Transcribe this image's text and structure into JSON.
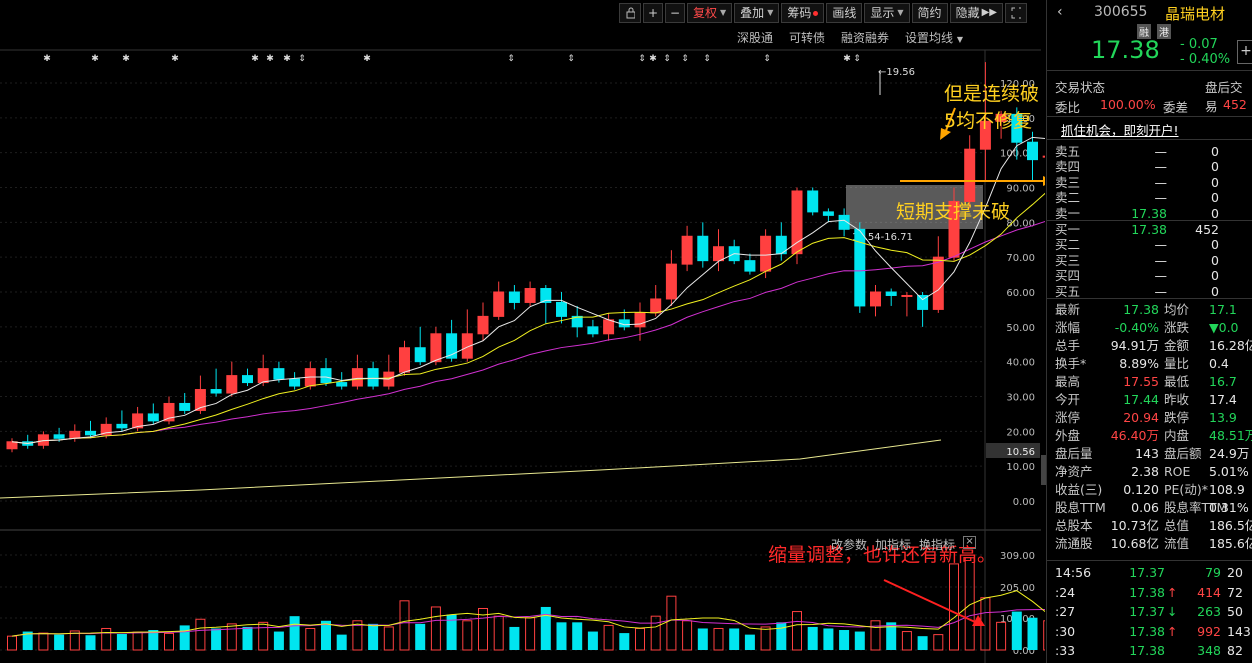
{
  "toolbar": {
    "items": [
      {
        "label": "复权",
        "dropdown": true,
        "active": true
      },
      {
        "label": "叠加",
        "dropdown": true
      },
      {
        "label": "筹码",
        "dot": true
      },
      {
        "label": "画线"
      },
      {
        "label": "显示",
        "dropdown": true
      },
      {
        "label": "简约"
      },
      {
        "label": "隐藏"
      }
    ],
    "sub_items": [
      "深股通",
      "可转债",
      "融资融券",
      "设置均线"
    ]
  },
  "annotations": {
    "top_note": "但是连续破5均不修复",
    "support_note": "短期支撑未破",
    "volume_note": "缩量调整，也许还有新高。",
    "high_marker": "19.56",
    "range_label": "15.54-16.71",
    "vol_buttons": [
      "改参数",
      "加指标",
      "换指标"
    ]
  },
  "price_axis": {
    "ticks": [
      "120.00",
      "110.00",
      "100.00",
      "90.00",
      "80.00",
      "70.00",
      "60.00",
      "50.00",
      "40.00",
      "30.00",
      "20.00",
      "10.00",
      "0.00"
    ],
    "current": "10.56"
  },
  "vol_axis": {
    "ticks": [
      "309.00",
      "205.00",
      "104.00",
      "0.00"
    ]
  },
  "quote": {
    "code": "300655",
    "name": "晶瑞电材",
    "tags": [
      "融",
      "港"
    ],
    "price": "17.38",
    "change": "- 0.07",
    "change_pct": "- 0.40%",
    "status_left": "交易状态",
    "status_right": "盘后交易",
    "weibi_label": "委比",
    "weibi": "100.00%",
    "weicha_label": "委差",
    "weicha": "452",
    "promo": "抓住机会，即刻开户!",
    "asks": [
      {
        "label": "卖五",
        "price": "—",
        "vol": "0"
      },
      {
        "label": "卖四",
        "price": "—",
        "vol": "0"
      },
      {
        "label": "卖三",
        "price": "—",
        "vol": "0"
      },
      {
        "label": "卖二",
        "price": "—",
        "vol": "0"
      },
      {
        "label": "卖一",
        "price": "17.38",
        "vol": "0"
      }
    ],
    "bids": [
      {
        "label": "买一",
        "price": "17.38",
        "vol": "452"
      },
      {
        "label": "买二",
        "price": "—",
        "vol": "0"
      },
      {
        "label": "买三",
        "price": "—",
        "vol": "0"
      },
      {
        "label": "买四",
        "price": "—",
        "vol": "0"
      },
      {
        "label": "买五",
        "price": "—",
        "vol": "0"
      }
    ],
    "stats": [
      {
        "l1": "最新",
        "v1": "17.38",
        "c1": "green",
        "l2": "均价",
        "v2": "17.1",
        "c2": "green"
      },
      {
        "l1": "涨幅",
        "v1": "-0.40%",
        "c1": "green",
        "l2": "涨跌",
        "v2": "▼0.0",
        "c2": "green"
      },
      {
        "l1": "总手",
        "v1": "94.91万",
        "c1": "white",
        "l2": "金额",
        "v2": "16.28亿",
        "c2": "white"
      },
      {
        "l1": "换手*",
        "v1": "8.89%",
        "c1": "white",
        "l2": "量比",
        "v2": "0.4",
        "c2": "white"
      },
      {
        "l1": "最高",
        "v1": "17.55",
        "c1": "red",
        "l2": "最低",
        "v2": "16.7",
        "c2": "green"
      },
      {
        "l1": "今开",
        "v1": "17.44",
        "c1": "green",
        "l2": "昨收",
        "v2": "17.4",
        "c2": "white"
      },
      {
        "l1": "涨停",
        "v1": "20.94",
        "c1": "red",
        "l2": "跌停",
        "v2": "13.9",
        "c2": "green"
      },
      {
        "l1": "外盘",
        "v1": "46.40万",
        "c1": "red",
        "l2": "内盘",
        "v2": "48.51万",
        "c2": "green"
      },
      {
        "l1": "盘后量",
        "v1": "143",
        "c1": "white",
        "l2": "盘后额",
        "v2": "24.9万",
        "c2": "white"
      },
      {
        "l1": "净资产",
        "v1": "2.38",
        "c1": "white",
        "l2": "ROE",
        "v2": "5.01%",
        "c2": "white"
      },
      {
        "l1": "收益(三)",
        "v1": "0.120",
        "c1": "white",
        "l2": "PE(动)*",
        "v2": "108.9",
        "c2": "white"
      },
      {
        "l1": "股息TTM",
        "v1": "0.06",
        "c1": "white",
        "l2": "股息率TTM",
        "v2": "0.31%",
        "c2": "white"
      },
      {
        "l1": "总股本",
        "v1": "10.73亿",
        "c1": "white",
        "l2": "总值",
        "v2": "186.5亿",
        "c2": "white"
      },
      {
        "l1": "流通股",
        "v1": "10.68亿",
        "c1": "white",
        "l2": "流值",
        "v2": "185.6亿",
        "c2": "white"
      }
    ],
    "ticks": [
      {
        "time": "14:56",
        "price": "17.37",
        "dir": "",
        "vol": "79",
        "n": "20"
      },
      {
        "time": ":24",
        "price": "17.38",
        "dir": "up",
        "vol": "414",
        "n": "72"
      },
      {
        "time": ":27",
        "price": "17.37",
        "dir": "down",
        "vol": "263",
        "n": "50"
      },
      {
        "time": ":30",
        "price": "17.38",
        "dir": "up",
        "vol": "992",
        "n": "143"
      },
      {
        "time": ":33",
        "price": "17.38",
        "dir": "",
        "vol": "348",
        "n": "82"
      }
    ]
  },
  "chart_data": {
    "type": "candlestick",
    "note": "Daily K-line, values in chart axis units (price axis 0-120, volume axis 0-309)",
    "candles": [
      [
        15,
        17,
        14,
        18
      ],
      [
        17,
        16,
        15,
        19
      ],
      [
        16,
        19,
        15,
        20
      ],
      [
        19,
        18,
        17,
        21
      ],
      [
        18,
        20,
        17,
        22
      ],
      [
        20,
        19,
        18,
        23
      ],
      [
        19,
        22,
        18,
        24
      ],
      [
        22,
        21,
        20,
        26
      ],
      [
        21,
        25,
        20,
        27
      ],
      [
        25,
        23,
        22,
        28
      ],
      [
        23,
        28,
        22,
        30
      ],
      [
        28,
        26,
        25,
        31
      ],
      [
        26,
        32,
        25,
        36
      ],
      [
        32,
        31,
        30,
        38
      ],
      [
        31,
        36,
        30,
        40
      ],
      [
        36,
        34,
        33,
        38
      ],
      [
        34,
        38,
        33,
        42
      ],
      [
        38,
        35,
        34,
        40
      ],
      [
        35,
        33,
        32,
        37
      ],
      [
        33,
        38,
        32,
        40
      ],
      [
        38,
        34,
        33,
        41
      ],
      [
        34,
        33,
        32,
        37
      ],
      [
        33,
        38,
        32,
        42
      ],
      [
        38,
        33,
        32,
        40
      ],
      [
        33,
        37,
        32,
        42
      ],
      [
        37,
        44,
        36,
        46
      ],
      [
        44,
        40,
        39,
        50
      ],
      [
        40,
        48,
        39,
        50
      ],
      [
        48,
        41,
        40,
        52
      ],
      [
        41,
        48,
        40,
        55
      ],
      [
        48,
        53,
        46,
        57
      ],
      [
        53,
        60,
        52,
        63
      ],
      [
        60,
        57,
        55,
        62
      ],
      [
        57,
        61,
        56,
        63
      ],
      [
        61,
        57,
        51,
        62
      ],
      [
        57,
        53,
        51,
        60
      ],
      [
        53,
        50,
        47,
        56
      ],
      [
        50,
        48,
        47,
        52
      ],
      [
        48,
        52,
        46,
        54
      ],
      [
        52,
        50,
        49,
        55
      ],
      [
        50,
        54,
        46,
        57
      ],
      [
        54,
        58,
        53,
        62
      ],
      [
        58,
        68,
        56,
        72
      ],
      [
        68,
        76,
        66,
        79
      ],
      [
        76,
        69,
        67,
        80
      ],
      [
        69,
        73,
        66,
        78
      ],
      [
        73,
        69,
        68,
        75
      ],
      [
        69,
        66,
        65,
        71
      ],
      [
        66,
        76,
        64,
        78
      ],
      [
        76,
        71,
        69,
        80
      ],
      [
        71,
        89,
        68,
        90
      ],
      [
        89,
        83,
        82,
        90
      ],
      [
        83,
        82,
        80,
        84
      ],
      [
        82,
        78,
        76,
        84
      ],
      [
        78,
        56,
        54,
        80
      ],
      [
        56,
        60,
        53,
        62
      ],
      [
        60,
        59,
        56,
        61
      ],
      [
        59,
        59,
        53,
        60
      ],
      [
        59,
        55,
        50,
        60
      ],
      [
        55,
        70,
        54,
        76
      ],
      [
        70,
        86,
        69,
        90
      ],
      [
        86,
        101,
        84,
        105
      ],
      [
        101,
        109,
        92,
        126
      ],
      [
        109,
        111,
        104,
        112
      ],
      [
        111,
        103,
        98,
        113
      ],
      [
        103,
        98,
        92,
        106
      ],
      [
        99,
        99,
        88,
        102
      ]
    ],
    "volume": [
      45,
      60,
      55,
      50,
      62,
      48,
      70,
      52,
      58,
      65,
      54,
      80,
      100,
      70,
      85,
      75,
      90,
      60,
      110,
      70,
      95,
      50,
      95,
      85,
      75,
      160,
      85,
      140,
      115,
      95,
      135,
      110,
      75,
      105,
      140,
      90,
      90,
      60,
      80,
      55,
      70,
      110,
      175,
      95,
      70,
      70,
      70,
      50,
      75,
      90,
      125,
      75,
      70,
      65,
      60,
      95,
      90,
      60,
      45,
      50,
      280,
      300,
      170,
      90,
      125,
      105,
      95
    ],
    "volume_colors": "up=red outline, down=cyan filled",
    "ma_colors": {
      "ma5": "#e8e8e8",
      "ma10": "#f0f020",
      "ma20": "#d030d0",
      "ma250": "#e8e890"
    }
  }
}
